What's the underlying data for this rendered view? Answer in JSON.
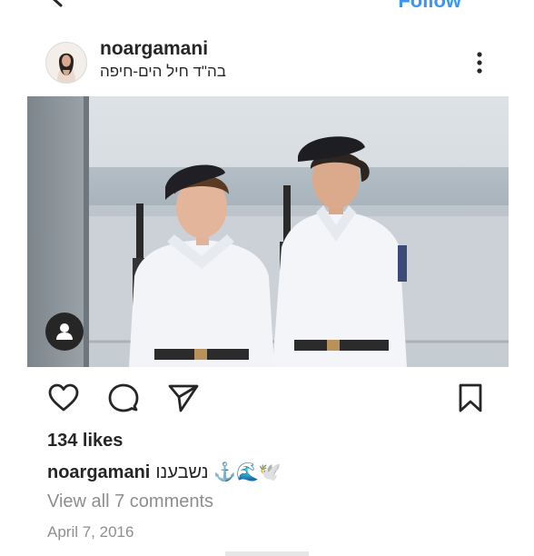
{
  "colors": {
    "accent": "#3897f0",
    "text": "#262626",
    "secondary_text": "#8e8e8e"
  },
  "topbar": {
    "back_icon": "chevron-left-icon",
    "follow_label": "Follow"
  },
  "post": {
    "username": "noargamani",
    "location": "בה\"ד חיל הים-חיפה",
    "more_icon": "more-vertical-icon",
    "photo": {
      "tagged_icon": "user-tag-icon"
    },
    "actions": {
      "like_icon": "heart-icon",
      "comment_icon": "comment-icon",
      "share_icon": "paper-plane-icon",
      "save_icon": "bookmark-icon"
    },
    "likes": "134 likes",
    "caption": {
      "username": "noargamani",
      "text": "נשבענו ⚓🌊🕊️"
    },
    "view_comments": "View all 7 comments",
    "date": "April 7, 2016"
  }
}
